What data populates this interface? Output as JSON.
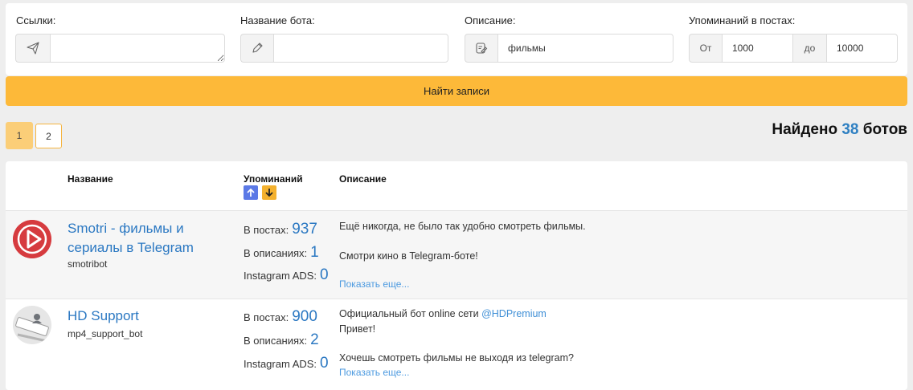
{
  "filters": {
    "links": {
      "label": "Ссылки:",
      "value": "",
      "icon": "paper-plane-icon"
    },
    "bot_name": {
      "label": "Название бота:",
      "value": "",
      "icon": "pencil-icon"
    },
    "description": {
      "label": "Описание:",
      "value": "фильмы",
      "icon": "document-edit-icon"
    },
    "mentions": {
      "label": "Упоминаний в постах:",
      "from_label": "От",
      "from_value": "1000",
      "to_label": "до",
      "to_value": "10000"
    }
  },
  "search_button": "Найти записи",
  "pagination": {
    "pages": [
      "1",
      "2"
    ],
    "active": "1"
  },
  "found": {
    "prefix": "Найдено",
    "count": "38",
    "suffix": "ботов"
  },
  "table": {
    "headers": {
      "name": "Название",
      "mentions": "Упоминаний",
      "description": "Описание"
    },
    "rows": [
      {
        "name": "Smotri - фильмы и сериалы в Telegram",
        "username": "smotribot",
        "avatar": "smotri-play-logo",
        "posts_label": "В постах:",
        "posts": "937",
        "desc_label": "В описаниях:",
        "desc_count": "1",
        "ads_label": "Instagram ADS:",
        "ads": "0",
        "desc_line1": "Ещё никогда, не было так удобно смотреть фильмы.",
        "desc_line2": "Смотри кино в Telegram-боте!",
        "more": "Показать еще..."
      },
      {
        "name": "HD Support",
        "username": "mp4_support_bot",
        "avatar": "support-stamp-logo",
        "posts_label": "В постах:",
        "posts": "900",
        "desc_label": "В описаниях:",
        "desc_count": "2",
        "ads_label": "Instagram ADS:",
        "ads": "0",
        "desc_line1_prefix": "Официальный бот online сети",
        "desc_line1_link": "@HDPremium",
        "desc_line2": "Привет!",
        "desc_line3": "Хочешь смотреть фильмы не выходя из telegram?",
        "more": "Показать еще..."
      }
    ]
  },
  "colors": {
    "accent": "#fdb939",
    "link": "#2b78c2",
    "sort_up": "#5b79e6",
    "sort_down": "#f4b12e"
  }
}
